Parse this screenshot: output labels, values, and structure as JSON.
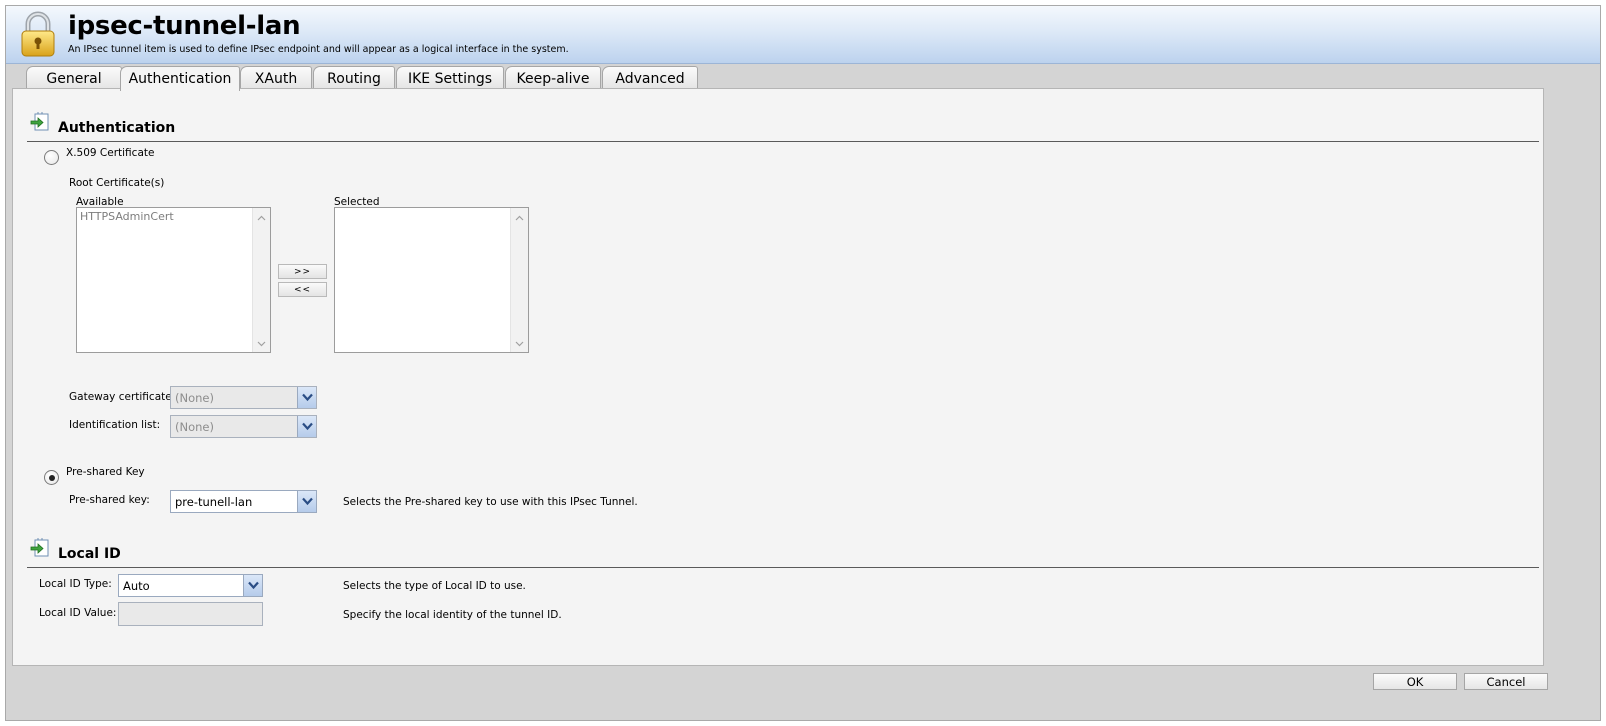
{
  "header": {
    "title": "ipsec-tunnel-lan",
    "subtitle": "An IPsec tunnel item is used to define IPsec endpoint and will appear as a logical interface in the system.",
    "icon": "lock-icon"
  },
  "tabs": [
    {
      "label": "General",
      "active": false
    },
    {
      "label": "Authentication",
      "active": true
    },
    {
      "label": "XAuth",
      "active": false
    },
    {
      "label": "Routing",
      "active": false
    },
    {
      "label": "IKE Settings",
      "active": false
    },
    {
      "label": "Keep-alive",
      "active": false
    },
    {
      "label": "Advanced",
      "active": false
    }
  ],
  "authentication": {
    "section_title": "Authentication",
    "x509": {
      "label": "X.509 Certificate",
      "checked": false,
      "root_certs_label": "Root Certificate(s)",
      "available_label": "Available",
      "available_items": [
        "HTTPSAdminCert"
      ],
      "selected_label": "Selected",
      "selected_items": [],
      "move_right_label": ">>",
      "move_left_label": "<<",
      "gateway_cert_label": "Gateway certificate:",
      "gateway_cert_value": "(None)",
      "identification_list_label": "Identification list:",
      "identification_list_value": "(None)"
    },
    "psk": {
      "label": "Pre-shared Key",
      "checked": true,
      "key_label": "Pre-shared key:",
      "key_value": "pre-tunell-lan",
      "key_description": "Selects the Pre-shared key to use with this IPsec Tunnel."
    }
  },
  "local_id": {
    "section_title": "Local ID",
    "type_label": "Local ID Type:",
    "type_value": "Auto",
    "type_description": "Selects the type of Local ID to use.",
    "value_label": "Local ID Value:",
    "value_value": "",
    "value_description": "Specify the local identity of the tunnel ID."
  },
  "footer": {
    "ok_label": "OK",
    "cancel_label": "Cancel"
  },
  "colors": {
    "header_gradient_top": "#f4f8fd",
    "header_gradient_bottom": "#bcd2ee",
    "panel_bg": "#f4f4f4",
    "frame_bg": "#d4d4d4"
  }
}
